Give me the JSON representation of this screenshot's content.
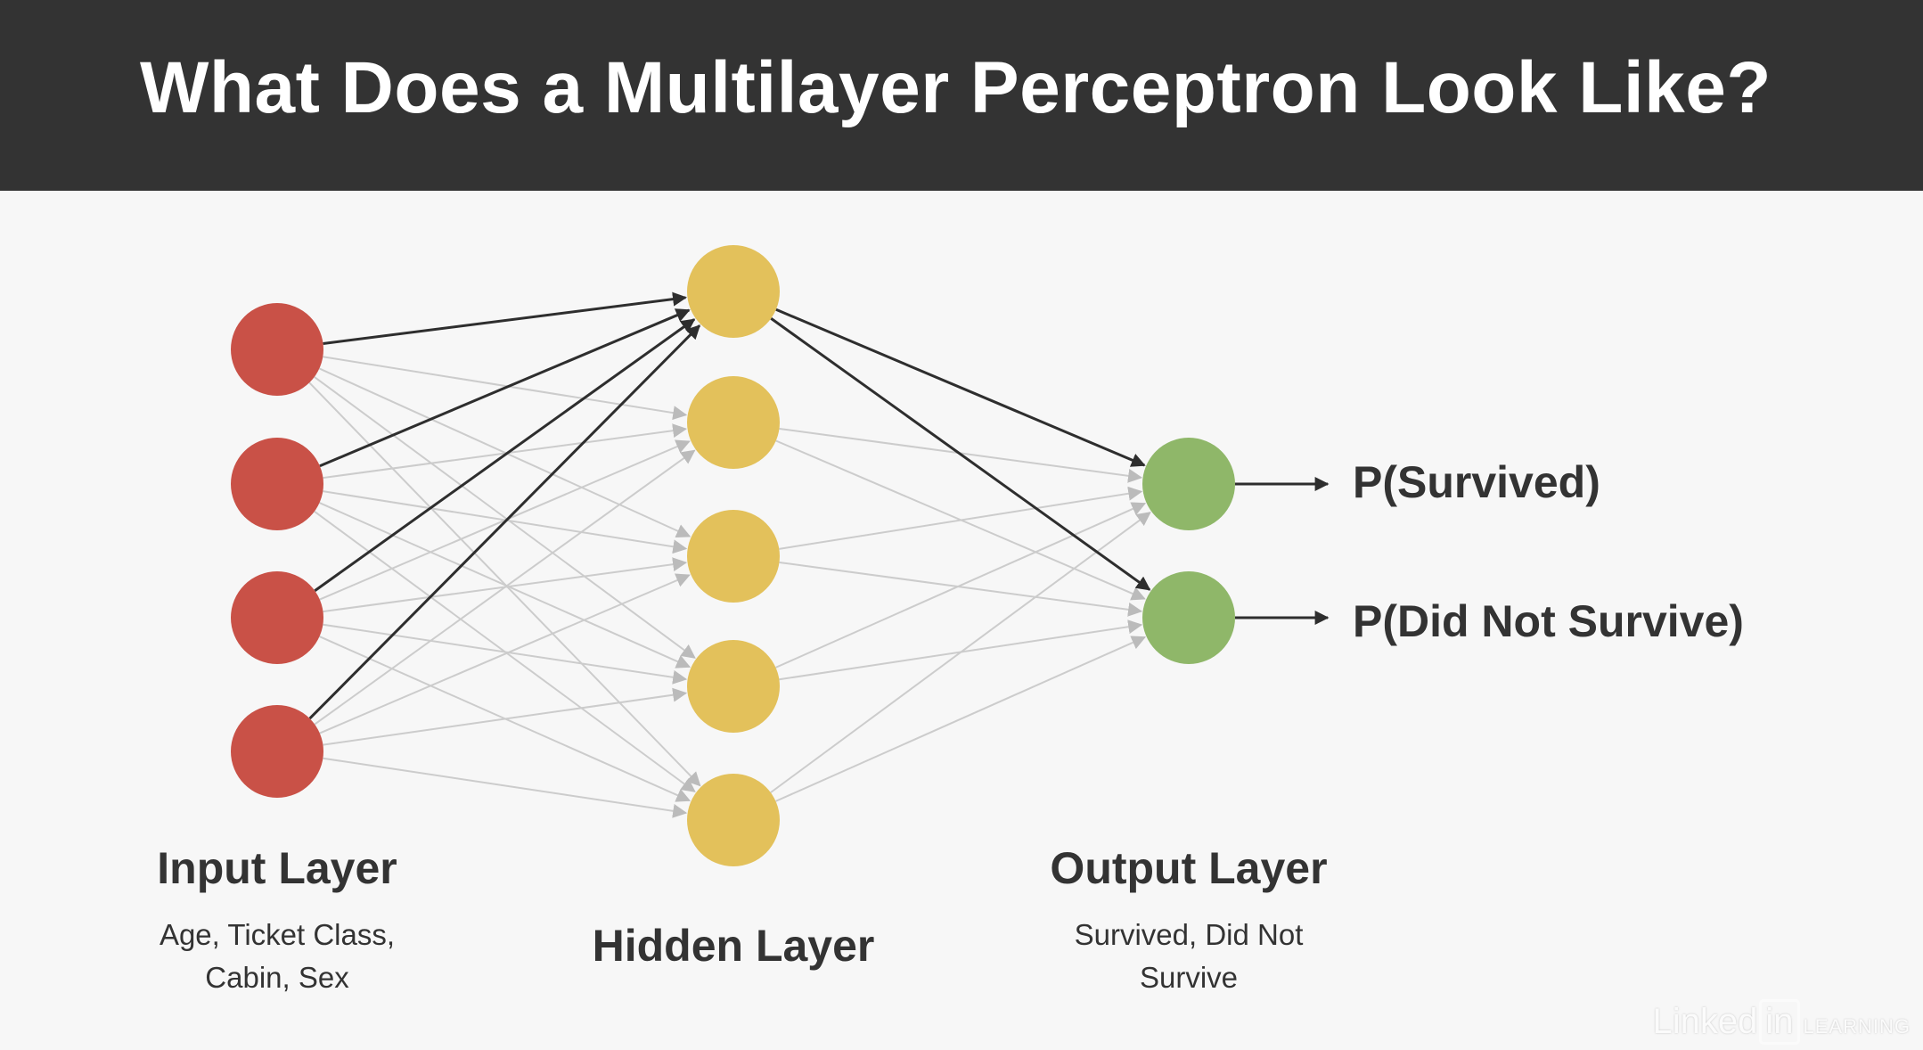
{
  "title": "What Does a Multilayer Perceptron Look Like?",
  "colors": {
    "header_bg": "#333333",
    "input_node": "#c95147",
    "hidden_node": "#e3c15b",
    "output_node": "#8fb769",
    "highlight_edge": "#2e2e2e",
    "faint_edge": "#cccccc"
  },
  "layers": {
    "input": {
      "label": "Input Layer",
      "sublabel": "Age, Ticket Class, Cabin, Sex",
      "node_count": 4
    },
    "hidden": {
      "label": "Hidden Layer",
      "node_count": 5
    },
    "output": {
      "label": "Output Layer",
      "sublabel": "Survived, Did Not Survive",
      "node_count": 2
    }
  },
  "outputs": [
    "P(Survived)",
    "P(Did Not Survive)"
  ],
  "highlighted_connections": [
    [
      "input-1",
      "hidden-1"
    ],
    [
      "input-2",
      "hidden-1"
    ],
    [
      "input-3",
      "hidden-1"
    ],
    [
      "input-4",
      "hidden-1"
    ],
    [
      "hidden-1",
      "output-1"
    ],
    [
      "hidden-1",
      "output-2"
    ]
  ],
  "watermark": {
    "brand": "Linked",
    "brand_box": "in",
    "suffix": "LEARNING"
  }
}
